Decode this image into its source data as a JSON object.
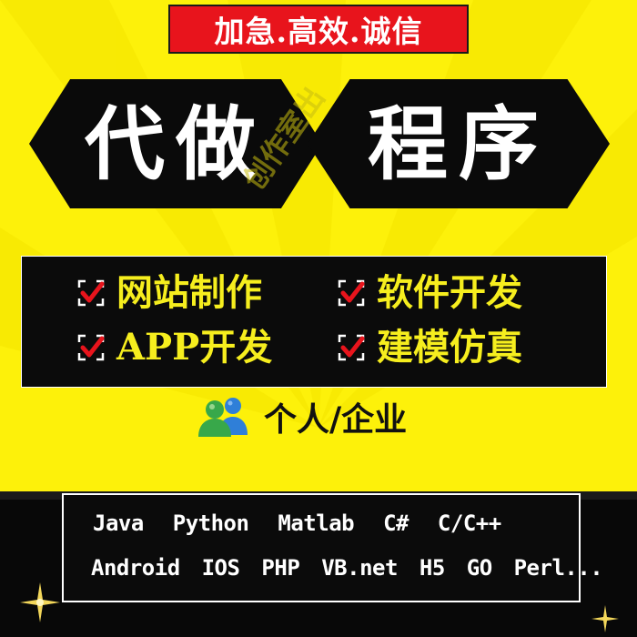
{
  "banner": {
    "text": "加急.高效.诚信"
  },
  "title": {
    "left": "代做",
    "right": "程序"
  },
  "watermark": {
    "text": "创作室出"
  },
  "services": [
    {
      "label": "网站制作",
      "icon": "checkbox-checked-icon"
    },
    {
      "label": "软件开发",
      "icon": "checkbox-checked-icon"
    },
    {
      "label": "APP开发",
      "icon": "checkbox-checked-icon"
    },
    {
      "label": "建模仿真",
      "icon": "checkbox-checked-icon"
    }
  ],
  "audience": {
    "label": "个人/企业",
    "icon": "people-icon"
  },
  "tech": {
    "line1": [
      "Java",
      "Python",
      "Matlab",
      "C#",
      "C/C++"
    ],
    "line2": [
      "Android",
      "IOS",
      "PHP",
      "VB.net",
      "H5",
      "GO",
      "Perl..."
    ]
  },
  "colors": {
    "background": "#fdf10a",
    "banner": "#e8141c",
    "panel": "#0b0b0b",
    "service_text": "#f6ee1e",
    "check": "#e8141c"
  }
}
